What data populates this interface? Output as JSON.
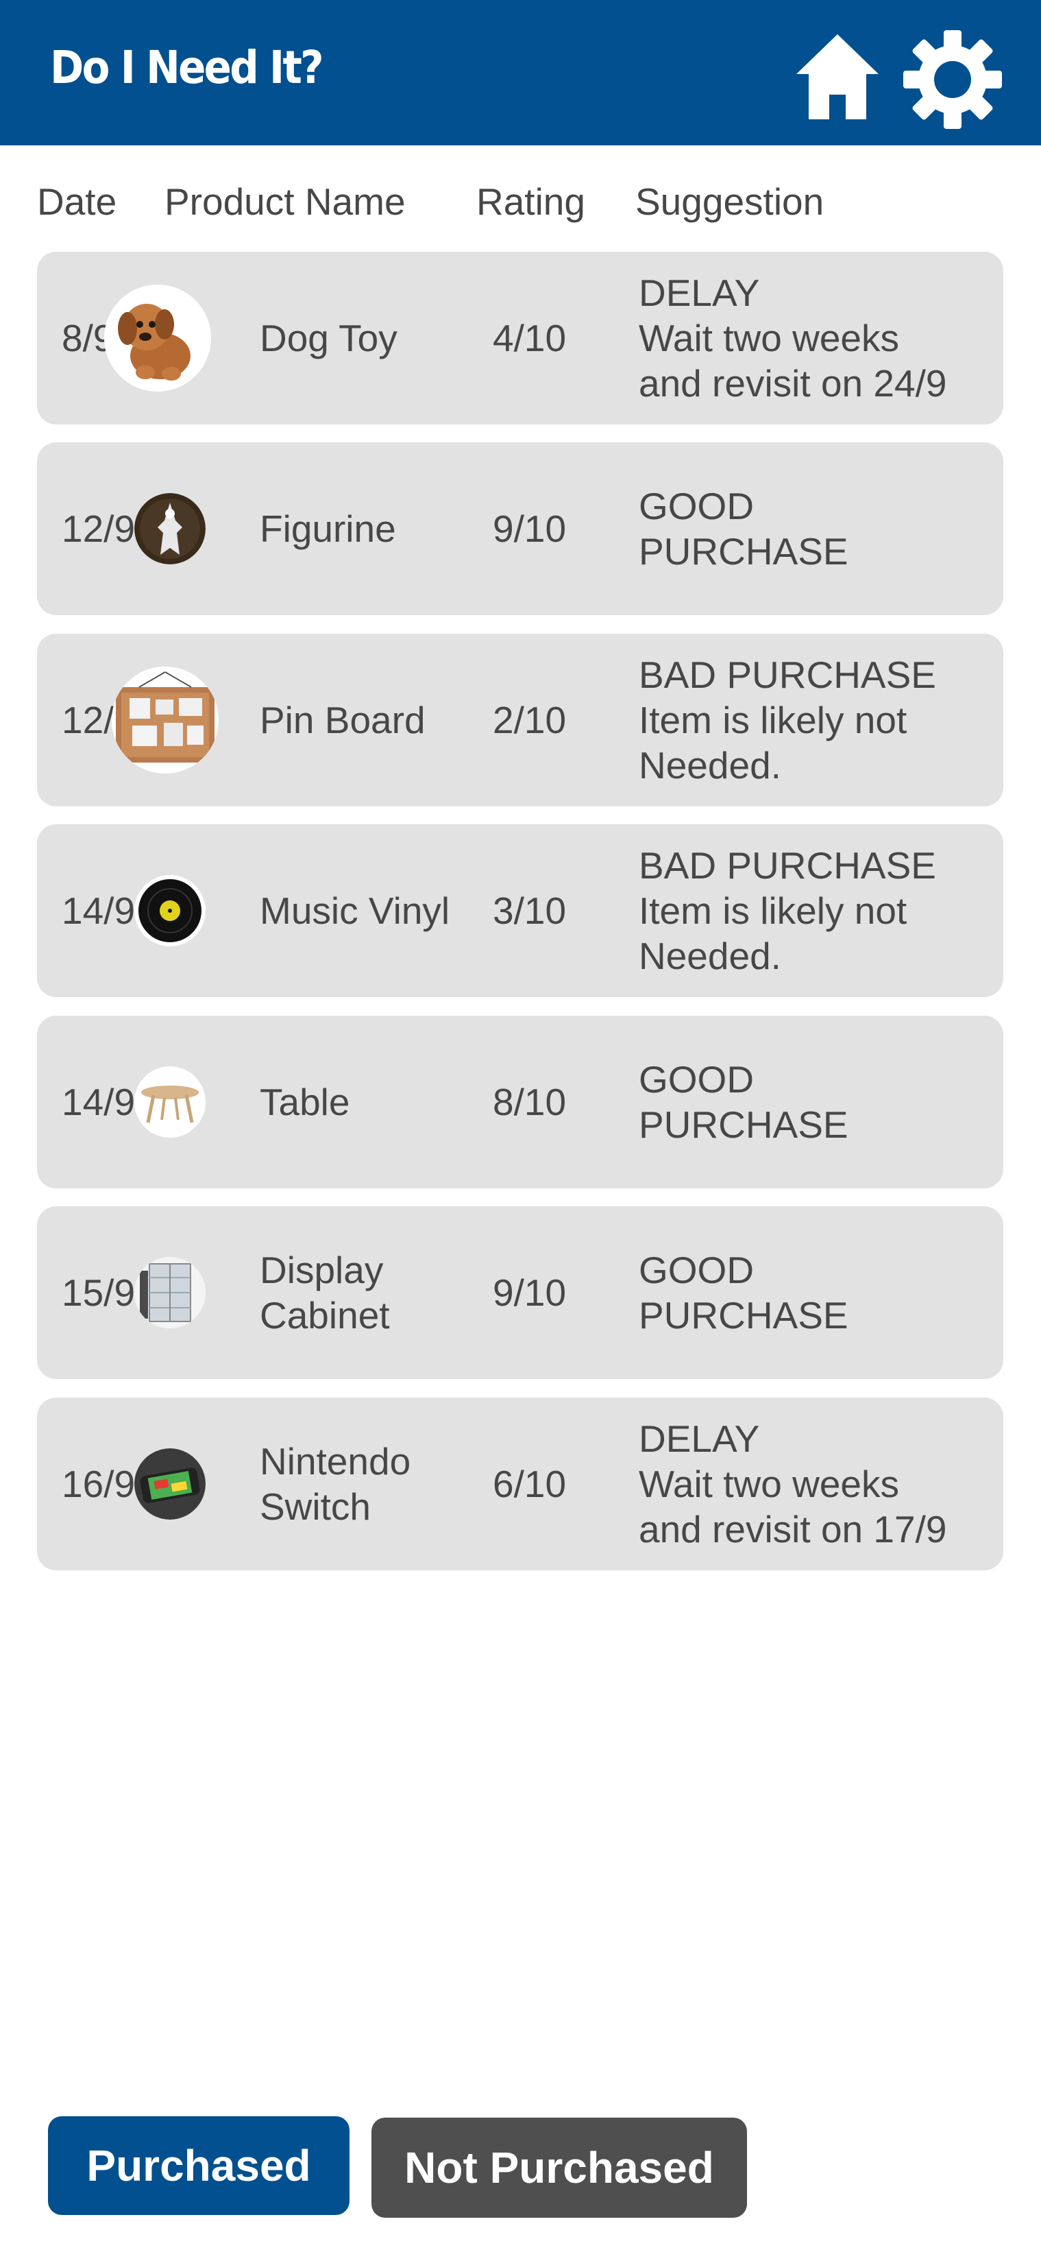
{
  "header": {
    "title": "Do I Need It?",
    "home_icon": "home-icon",
    "settings_icon": "gear-icon",
    "color": "#02508f"
  },
  "columns": {
    "date": "Date",
    "product": "Product Name",
    "rating": "Rating",
    "suggestion": "Suggestion"
  },
  "rows": [
    {
      "date": "8/9",
      "product": [
        "Dog Toy"
      ],
      "image": "dog-toy-image",
      "rating": "4/10",
      "suggestion": [
        "DELAY",
        "Wait two weeks",
        "and revisit on 24/9"
      ]
    },
    {
      "date": "12/9",
      "product": [
        "Figurine"
      ],
      "image": "figurine-image",
      "rating": "9/10",
      "suggestion": [
        "GOOD",
        "PURCHASE"
      ]
    },
    {
      "date": "12/9",
      "product": [
        "Pin Board"
      ],
      "image": "pin-board-image",
      "rating": "2/10",
      "suggestion": [
        "BAD PURCHASE",
        "Item is likely not",
        "Needed."
      ]
    },
    {
      "date": "14/9",
      "product": [
        "Music Vinyl"
      ],
      "image": "vinyl-image",
      "rating": "3/10",
      "suggestion": [
        "BAD PURCHASE",
        "Item is likely not",
        "Needed."
      ]
    },
    {
      "date": "14/9",
      "product": [
        "Table"
      ],
      "image": "table-image",
      "rating": "8/10",
      "suggestion": [
        "GOOD",
        "PURCHASE"
      ]
    },
    {
      "date": "15/9",
      "product": [
        "Display",
        "Cabinet"
      ],
      "image": "display-cabinet-image",
      "rating": "9/10",
      "suggestion": [
        "GOOD",
        "PURCHASE"
      ]
    },
    {
      "date": "16/9",
      "product": [
        "Nintendo",
        "Switch"
      ],
      "image": "nintendo-switch-image",
      "rating": "6/10",
      "suggestion": [
        "DELAY",
        "Wait two weeks",
        "and revisit on 17/9"
      ]
    }
  ],
  "buttons": {
    "purchased": "Purchased",
    "not_purchased": "Not Purchased"
  },
  "colors": {
    "primary": "#02508f",
    "row_bg": "#e2e2e2",
    "secondary_button": "#4f4f4f"
  }
}
